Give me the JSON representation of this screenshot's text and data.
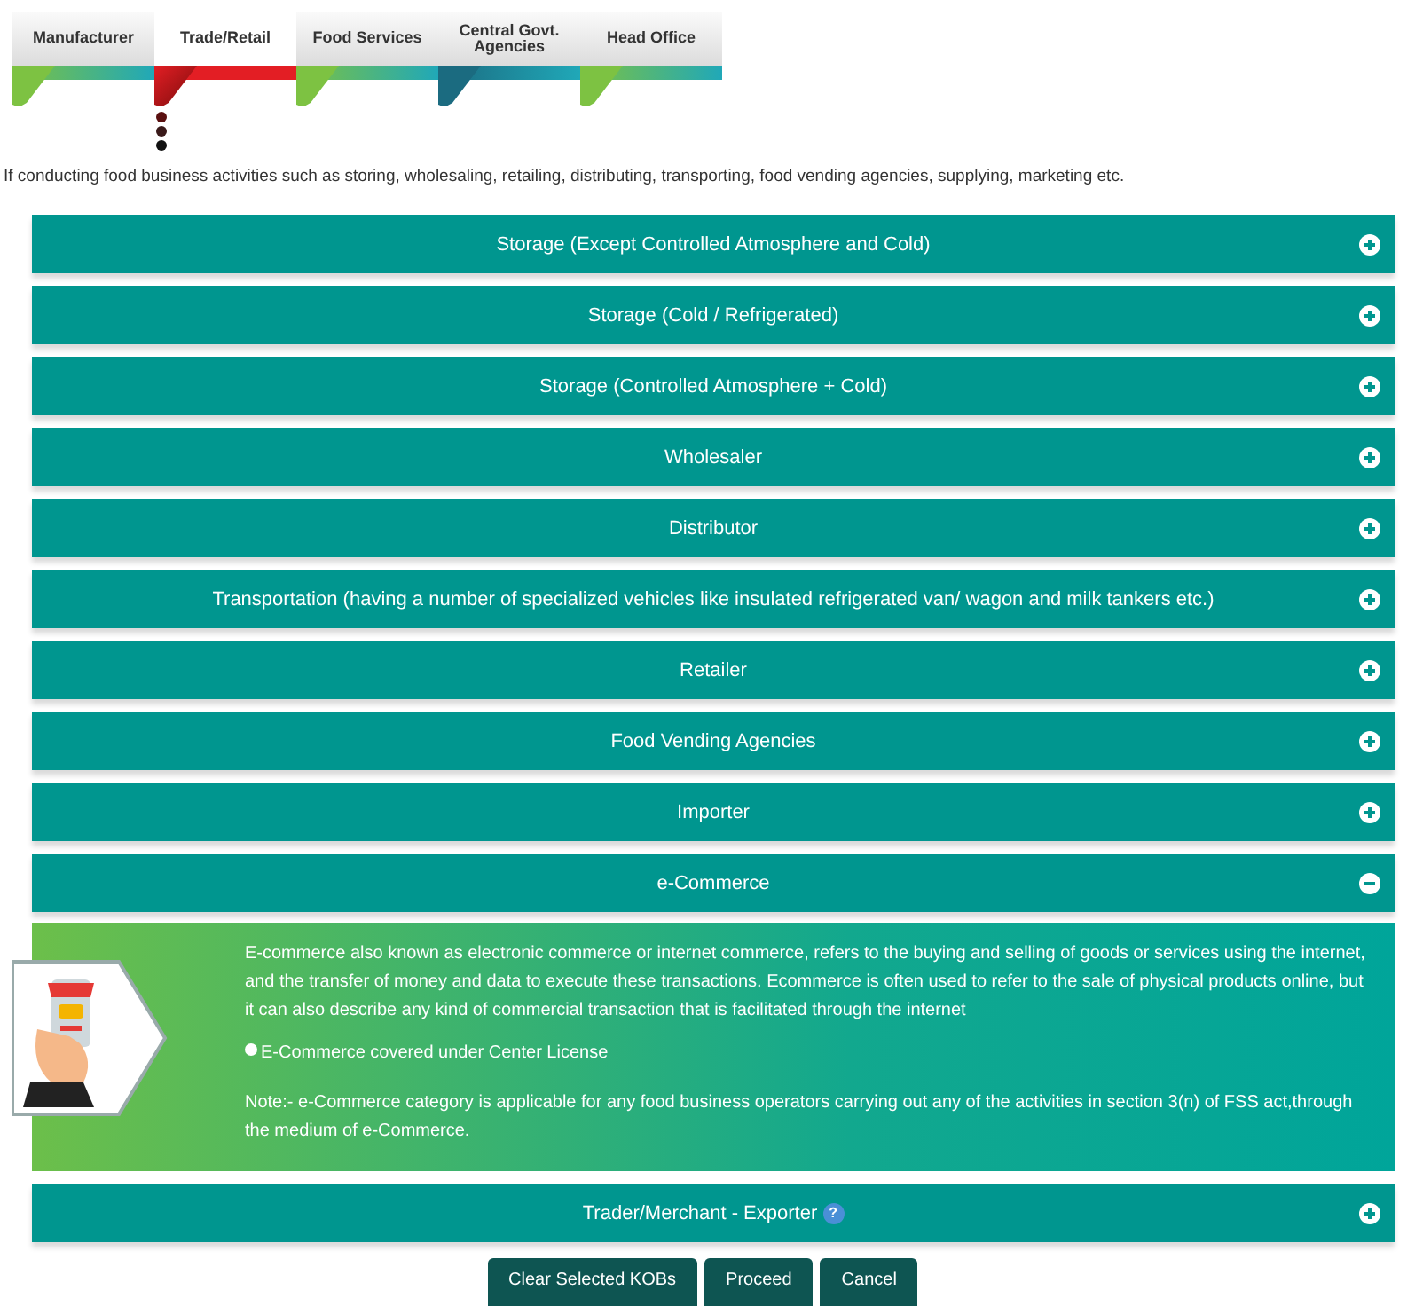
{
  "tabs": [
    {
      "label": "Manufacturer",
      "selected": false,
      "color": "#7dc242"
    },
    {
      "label": "Trade/Retail",
      "selected": true,
      "color": "#e31e24"
    },
    {
      "label": "Food Services",
      "selected": false,
      "color": "#7dc242"
    },
    {
      "label": "Central Govt. Agencies",
      "selected": false,
      "color": "#1b6b80"
    },
    {
      "label": "Head Office",
      "selected": false,
      "color": "#7dc242"
    }
  ],
  "intro": "If conducting food business activities such as storing, wholesaling, retailing, distributing, transporting, food vending agencies, supplying, marketing etc.",
  "categories": [
    {
      "title": "Storage (Except Controlled Atmosphere and Cold)",
      "expanded": false
    },
    {
      "title": "Storage (Cold / Refrigerated)",
      "expanded": false
    },
    {
      "title": "Storage (Controlled Atmosphere + Cold)",
      "expanded": false
    },
    {
      "title": "Wholesaler",
      "expanded": false
    },
    {
      "title": "Distributor",
      "expanded": false
    },
    {
      "title": "Transportation (having a number of specialized vehicles like insulated refrigerated van/ wagon and milk tankers etc.)",
      "expanded": false
    },
    {
      "title": "Retailer",
      "expanded": false
    },
    {
      "title": "Food Vending Agencies",
      "expanded": false
    },
    {
      "title": "Importer",
      "expanded": false
    },
    {
      "title": "e-Commerce",
      "expanded": true,
      "description": "E-commerce also known as electronic commerce or internet commerce, refers to the buying and selling of goods or services using the internet, and the transfer of money and data to execute these transactions. Ecommerce is often used to refer to the sale of physical products online, but it can also describe any kind of commercial transaction that is facilitated through the internet",
      "option": {
        "label": "E-Commerce covered under Center License",
        "checked": false
      },
      "note": "Note:- e-Commerce category is applicable for any food business operators carrying out any of the activities in section 3(n) of FSS act,through the medium of e-Commerce."
    },
    {
      "title": "Trader/Merchant - Exporter",
      "expanded": false,
      "help": "?"
    }
  ],
  "buttons": [
    "Clear Selected KOBs",
    "Proceed",
    "Cancel"
  ]
}
